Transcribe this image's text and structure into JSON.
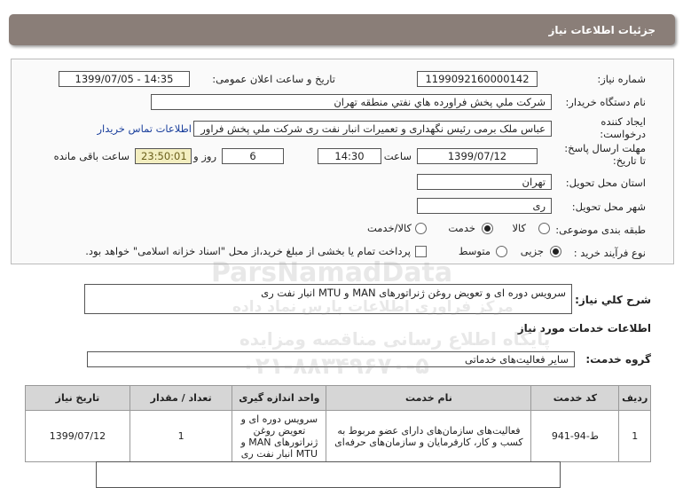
{
  "header": {
    "title": "جزئیات اطلاعات نیاز"
  },
  "form": {
    "need_number_label": "شماره نیاز:",
    "need_number": "1199092160000142",
    "announce_label": "تاریخ و ساعت اعلان عمومی:",
    "announce_value": "1399/07/05 - 14:35",
    "buyer_label": "نام دستگاه خریدار:",
    "buyer_value": "شرکت ملي پخش فراورده هاي نفتي منطقه تهران",
    "creator_label_1": "ایجاد کننده",
    "creator_label_2": "درخواست:",
    "creator_value": "عباس ملک برمی رئیس نگهداری و تعمیرات انبار نفت ری شرکت ملي پخش فراور",
    "contact_link": "اطلاعات تماس خریدار",
    "deadline_label_1": "مهلت ارسال پاسخ:",
    "deadline_label_2": "تا تاریخ:",
    "deadline_date": "1399/07/12",
    "time_label": "ساعت",
    "deadline_time": "14:30",
    "days_label": "روز و",
    "days_value": "6",
    "remaining_time": "23:50:01",
    "remaining_label": "ساعت باقی مانده",
    "province_label": "استان محل تحویل:",
    "province_value": "تهران",
    "city_label": "شهر محل تحویل:",
    "city_value": "ری",
    "category_label": "طبقه بندی موضوعی:",
    "category_options": [
      "کالا",
      "خدمت",
      "کالا/خدمت"
    ],
    "category_selected": "خدمت",
    "process_label": "نوع فرآیند خرید :",
    "process_options": [
      "جزیی",
      "متوسط"
    ],
    "process_selected": "جزیی",
    "payment_note": "پرداخت تمام یا بخشی از مبلغ خرید،از محل \"اسناد خزانه اسلامی\" خواهد بود."
  },
  "description": {
    "label": "شرح کلي نياز:",
    "value": "سرویس دوره ای و تعویض روغن ژنراتورهای MAN و MTU انبار نفت ری"
  },
  "services": {
    "section_title": "اطلاعات خدمات مورد نیاز",
    "group_label": "گروه خدمت:",
    "group_value": "سایر فعالیت‌های خدماتی",
    "columns": [
      "ردیف",
      "کد خدمت",
      "نام خدمت",
      "واحد اندازه گیری",
      "تعداد / مقدار",
      "تاریخ نیاز"
    ],
    "rows": [
      {
        "index": "1",
        "code": "ط-94-941",
        "name": "فعالیت‌های سازمان‌های دارای عضو مربوط به کسب و کار، کارفرمایان و سازمان‌های حرفه‌ای",
        "unit": "سرویس دوره ای و تعویض روغن ژنراتورهای MAN و MTU انبار نفت ری",
        "quantity": "1",
        "date": "1399/07/12"
      }
    ]
  },
  "watermark": {
    "line1": "ParsNamadData",
    "line2": "مرکز فراوری اطلاعات پارس نماد داده",
    "line3": "پایگاه اطلاع رسانی مناقصه ومزایده",
    "line4": "۰۲۱-۸۸۳۴۹۶۷۰-۵"
  }
}
